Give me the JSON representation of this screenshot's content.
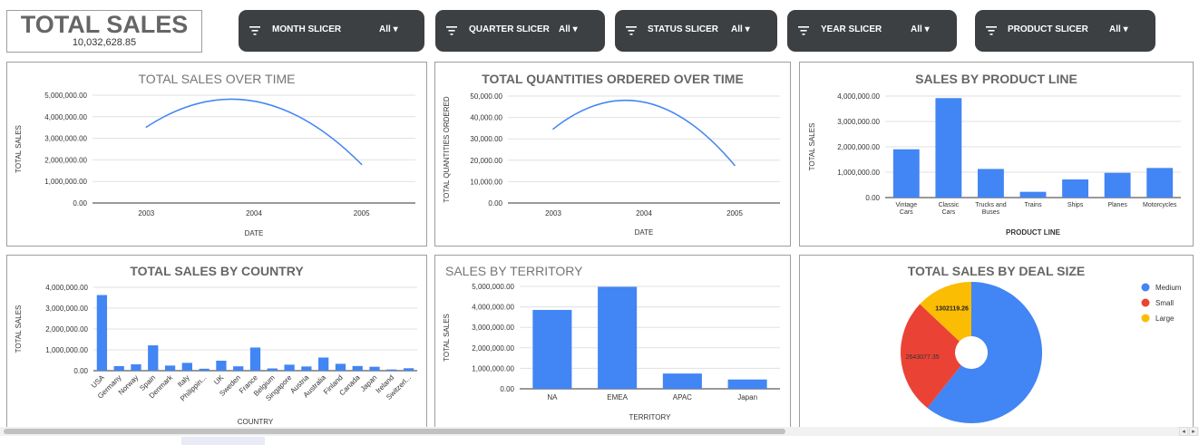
{
  "kpi": {
    "title": "TOTAL SALES",
    "value": "10,032,628.85"
  },
  "slicers": [
    {
      "label": "MONTH SLICER",
      "value": "All"
    },
    {
      "label": "QUARTER SLICER",
      "value": "All"
    },
    {
      "label": "STATUS SLICER",
      "value": "All"
    },
    {
      "label": "YEAR SLICER",
      "value": "All"
    },
    {
      "label": "PRODUCT SLICER",
      "value": "All"
    }
  ],
  "colors": {
    "bar": "#4285f4",
    "line": "#4285f4",
    "medium": "#4285f4",
    "small": "#ea4335",
    "large": "#fbbc04"
  },
  "icons": {
    "slicer": "filter-icon",
    "dropdown": "caret-down-icon"
  },
  "chart_data": [
    {
      "type": "line",
      "title": "TOTAL SALES OVER TIME",
      "xlabel": "DATE",
      "ylabel": "TOTAL SALES",
      "x": [
        "2003",
        "2004",
        "2005"
      ],
      "y": [
        3516979.54,
        4724162.6,
        1791486.71
      ],
      "yticks": [
        "5,000,000.00",
        "4,000,000.00",
        "3,000,000.00",
        "2,000,000.00",
        "1,000,000.00",
        "0.00"
      ],
      "ylim": [
        0,
        5000000
      ],
      "grid": true
    },
    {
      "type": "line",
      "title": "TOTAL QUANTITIES ORDERED OVER TIME",
      "xlabel": "DATE",
      "ylabel": "TOTAL QUANTITIES ORDERED",
      "x": [
        "2003",
        "2004",
        "2005"
      ],
      "y": [
        34612,
        47151,
        17631
      ],
      "yticks": [
        "50,000.00",
        "40,000.00",
        "30,000.00",
        "20,000.00",
        "10,000.00",
        "0.00"
      ],
      "ylim": [
        0,
        50000
      ],
      "grid": true
    },
    {
      "type": "bar",
      "title": "SALES BY PRODUCT LINE",
      "xlabel": "PRODUCT LINE",
      "ylabel": "TOTAL SALES",
      "categories": [
        "Vintage Cars",
        "Classic Cars",
        "Trucks and Buses",
        "Trains",
        "Ships",
        "Planes",
        "Motorcycles"
      ],
      "values": [
        1903150.84,
        3919615.66,
        1127789.84,
        226243.47,
        714437.13,
        975003.57,
        1166388.34
      ],
      "yticks": [
        "4,000,000.00",
        "3,000,000.00",
        "2,000,000.00",
        "1,000,000.00",
        "0.00"
      ],
      "ylim": [
        0,
        4000000
      ],
      "grid": true
    },
    {
      "type": "bar",
      "title": "TOTAL SALES BY COUNTRY",
      "xlabel": "COUNTRY",
      "ylabel": "TOTAL SALES",
      "categories": [
        "USA",
        "Germany",
        "Norway",
        "Spain",
        "Denmark",
        "Italy",
        "Philippin...",
        "UK",
        "Sweden",
        "France",
        "Belgium",
        "Singapore",
        "Austria",
        "Australia",
        "Finland",
        "Canada",
        "Japan",
        "Ireland",
        "Switzerl..."
      ],
      "values": [
        3627982.83,
        220472.09,
        307463.7,
        1215686.92,
        245637.15,
        374674.31,
        94015.73,
        478880.46,
        210014.21,
        1110916.52,
        108412.62,
        288488.41,
        202062.53,
        630623.1,
        329581.91,
        224078.56,
        188167.81,
        57756.43,
        117713.56
      ],
      "yticks": [
        "4,000,000.00",
        "3,000,000.00",
        "2,000,000.00",
        "1,000,000.00",
        "0.00"
      ],
      "ylim": [
        0,
        4000000
      ],
      "grid": true
    },
    {
      "type": "bar",
      "title": "SALES BY TERRITORY",
      "xlabel": "TERRITORY",
      "ylabel": "TOTAL SALES",
      "categories": [
        "NA",
        "EMEA",
        "APAC",
        "Japan"
      ],
      "values": [
        3852061.39,
        4979272.41,
        746121.83,
        455173.22
      ],
      "yticks": [
        "5,000,000.00",
        "4,000,000.00",
        "3,000,000.00",
        "2,000,000.00",
        "1,000,000.00",
        "0.00"
      ],
      "ylim": [
        0,
        5000000
      ],
      "grid": true
    },
    {
      "type": "pie",
      "title": "TOTAL SALES BY DEAL SIZE",
      "donut": true,
      "legend": "right",
      "series": [
        {
          "name": "Medium",
          "value": 6087432.24
        },
        {
          "name": "Small",
          "value": 2643077.35
        },
        {
          "name": "Large",
          "value": 1302119.26
        }
      ],
      "data_labels": [
        "",
        "2643077.35",
        "1302119.26"
      ]
    }
  ]
}
